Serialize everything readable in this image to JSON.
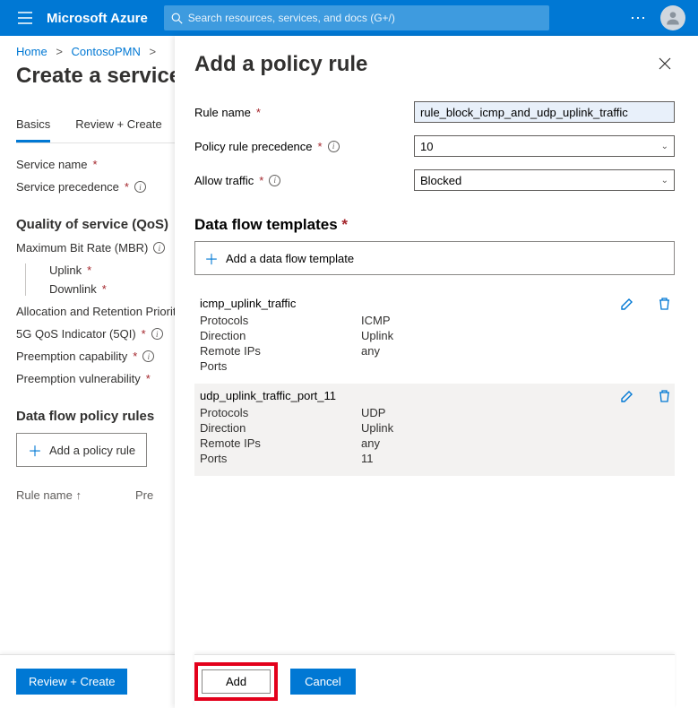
{
  "topbar": {
    "brand": "Microsoft Azure",
    "search_placeholder": "Search resources, services, and docs (G+/)"
  },
  "breadcrumb": {
    "home": "Home",
    "item1": "ContosoPMN"
  },
  "bg": {
    "title": "Create a service",
    "tabs": {
      "basics": "Basics",
      "review": "Review + Create"
    },
    "labels": {
      "service_name": "Service name",
      "service_precedence": "Service precedence",
      "qos_heading": "Quality of service (QoS)",
      "mbr": "Maximum Bit Rate (MBR)",
      "uplink": "Uplink",
      "downlink": "Downlink",
      "allocation": "Allocation and Retention Priority",
      "fiveg_qos": "5G QoS Indicator (5QI)",
      "preempt_cap": "Preemption capability",
      "preempt_vuln": "Preemption vulnerability",
      "rules_heading": "Data flow policy rules",
      "add_rule": "Add a policy rule",
      "col_rule": "Rule name",
      "col_pre": "Pre"
    },
    "footer": {
      "review_btn": "Review + Create"
    }
  },
  "panel": {
    "title": "Add a policy rule",
    "labels": {
      "rule_name": "Rule name",
      "precedence": "Policy rule precedence",
      "allow_traffic": "Allow traffic",
      "templates_heading": "Data flow templates",
      "add_template": "Add a data flow template",
      "k_protocols": "Protocols",
      "k_direction": "Direction",
      "k_remoteips": "Remote IPs",
      "k_ports": "Ports"
    },
    "values": {
      "rule_name": "rule_block_icmp_and_udp_uplink_traffic",
      "precedence": "10",
      "allow_traffic": "Blocked"
    },
    "templates": [
      {
        "name": "icmp_uplink_traffic",
        "protocols": "ICMP",
        "direction": "Uplink",
        "remote_ips": "any",
        "ports": ""
      },
      {
        "name": "udp_uplink_traffic_port_11",
        "protocols": "UDP",
        "direction": "Uplink",
        "remote_ips": "any",
        "ports": "11"
      }
    ],
    "footer": {
      "add": "Add",
      "cancel": "Cancel"
    }
  }
}
